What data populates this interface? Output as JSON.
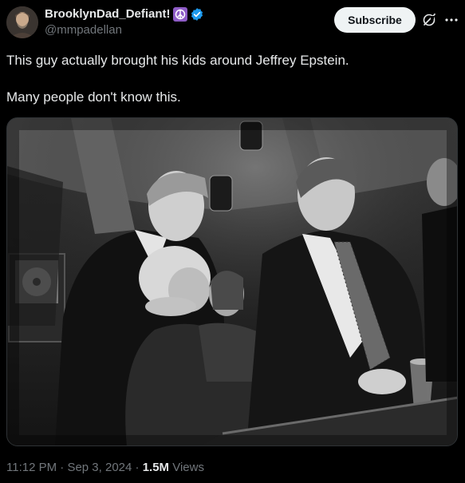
{
  "author": {
    "display_name": "BrooklynDad_Defiant!",
    "handle": "@mmpadellan",
    "badge_emoji": "peace-symbol-icon",
    "verified_color": "#1d9bf0"
  },
  "actions": {
    "subscribe_label": "Subscribe"
  },
  "tweet": {
    "line1": "This guy actually brought his kids around Jeffrey Epstein.",
    "line2": "Many people don't know this."
  },
  "media": {
    "type": "black-and-white photograph"
  },
  "meta": {
    "time": "11:12 PM",
    "separator": "·",
    "date": "Sep 3, 2024",
    "views_count": "1.5M",
    "views_label": "Views"
  },
  "colors": {
    "background": "#000000",
    "text_primary": "#e7e9ea",
    "text_secondary": "#71767b",
    "button_bg": "#eff3f4",
    "badge_purple": "#8e5cc6"
  }
}
